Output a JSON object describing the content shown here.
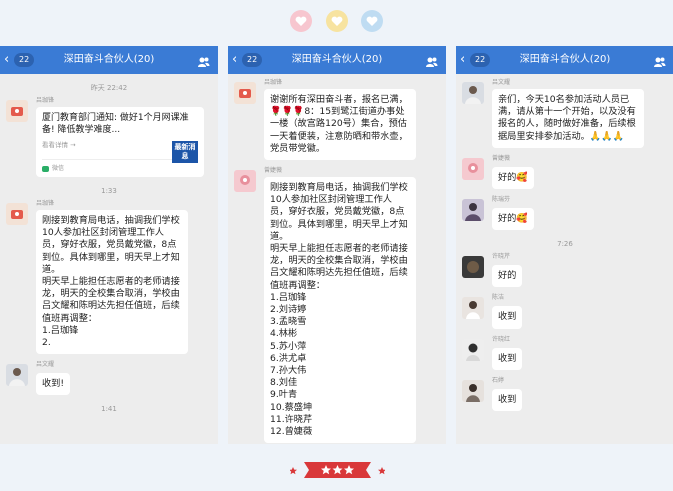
{
  "chat_title": "深田奋斗合伙人(20)",
  "unread_count": "22",
  "panel1": {
    "time1": "昨天 22:42",
    "card_nick": "吕珈锋",
    "card_title": "厦门教育部门通知: 做好1个月网课准备! 降低教学难度...",
    "card_sub": "看看详情 →",
    "card_thumb": "最新消息",
    "card_source": "微信",
    "time2": "1:33",
    "msg1_nick": "吕珈锋",
    "msg1_text": "刚接到教育局电话，抽调我们学校10人参加社区封闭管理工作人员，穿好衣服，党员戴党徽，8点到位。具体到哪里，明天早上才知道。\n明天早上能担任志愿者的老师请接龙，明天的全校集合取消，学校由吕文耀和陈明达先担任值班，后续值班再调整：\n1.吕珈锋\n2.",
    "msg2_nick": "吕文耀",
    "msg2_text": "收到!",
    "time3": "1:41"
  },
  "panel2": {
    "msg1_nick": "吕珈锋",
    "msg1_text": "谢谢所有深田奋斗者，报名已满，🌹🌹🌹8：15到鹭江街道办事处一楼（故宫路120号）集合，预估一天着便装，注意防晒和带水壶，党员带党徽。",
    "msg2_nick": "曾婕薇",
    "msg2_text": "刚接到教育局电话，抽调我们学校10人参加社区封闭管理工作人员，穿好衣服，党员戴党徽，8点到位。具体到哪里，明天早上才知道。\n明天早上能担任志愿者的老师请接龙，明天的全校集合取消，学校由吕文耀和陈明达先担任值班，后续值班再调整：\n1.吕珈锋\n2.刘诗婷\n3.孟晓雪\n4.林彬\n5.苏小萍\n6.洪尤卓\n7.孙大伟\n8.刘佳\n9.叶青\n10.蔡盛坤\n11.许晓芹\n12.曾婕薇"
  },
  "panel3": {
    "msg1_nick": "吕文耀",
    "msg1_text": "亲们，今天10名参加活动人员已满，请从第十一个开始，以及没有报名的人，随时做好准备，后续根据局里安排参加活动。🙏🙏🙏",
    "msg2_nick": "曾婕薇",
    "msg2_text": "好的🥰",
    "msg3_nick": "陈瑞芬",
    "msg3_text": "好的🥰",
    "time1": "7:26",
    "msg4_nick": "许晓芹",
    "msg4_text": "好的",
    "msg5_nick": "陈洁",
    "msg5_text": "收到",
    "msg6_nick": "许晓红",
    "msg6_text": "收到",
    "msg7_nick": "石婷",
    "msg7_text": "收到"
  },
  "colors": {
    "title_bar": "#3a7bd5",
    "background": "#eef3f9",
    "chat_bg": "#ededed",
    "heart_pink": "#f7c6cf",
    "heart_yellow": "#f7e3a0",
    "heart_blue": "#bfdcf2",
    "ribbon_red": "#d9383a"
  },
  "icons": [
    "back-chevron-icon",
    "people-icon",
    "heart-icon",
    "star-icon",
    "wechat-icon"
  ]
}
